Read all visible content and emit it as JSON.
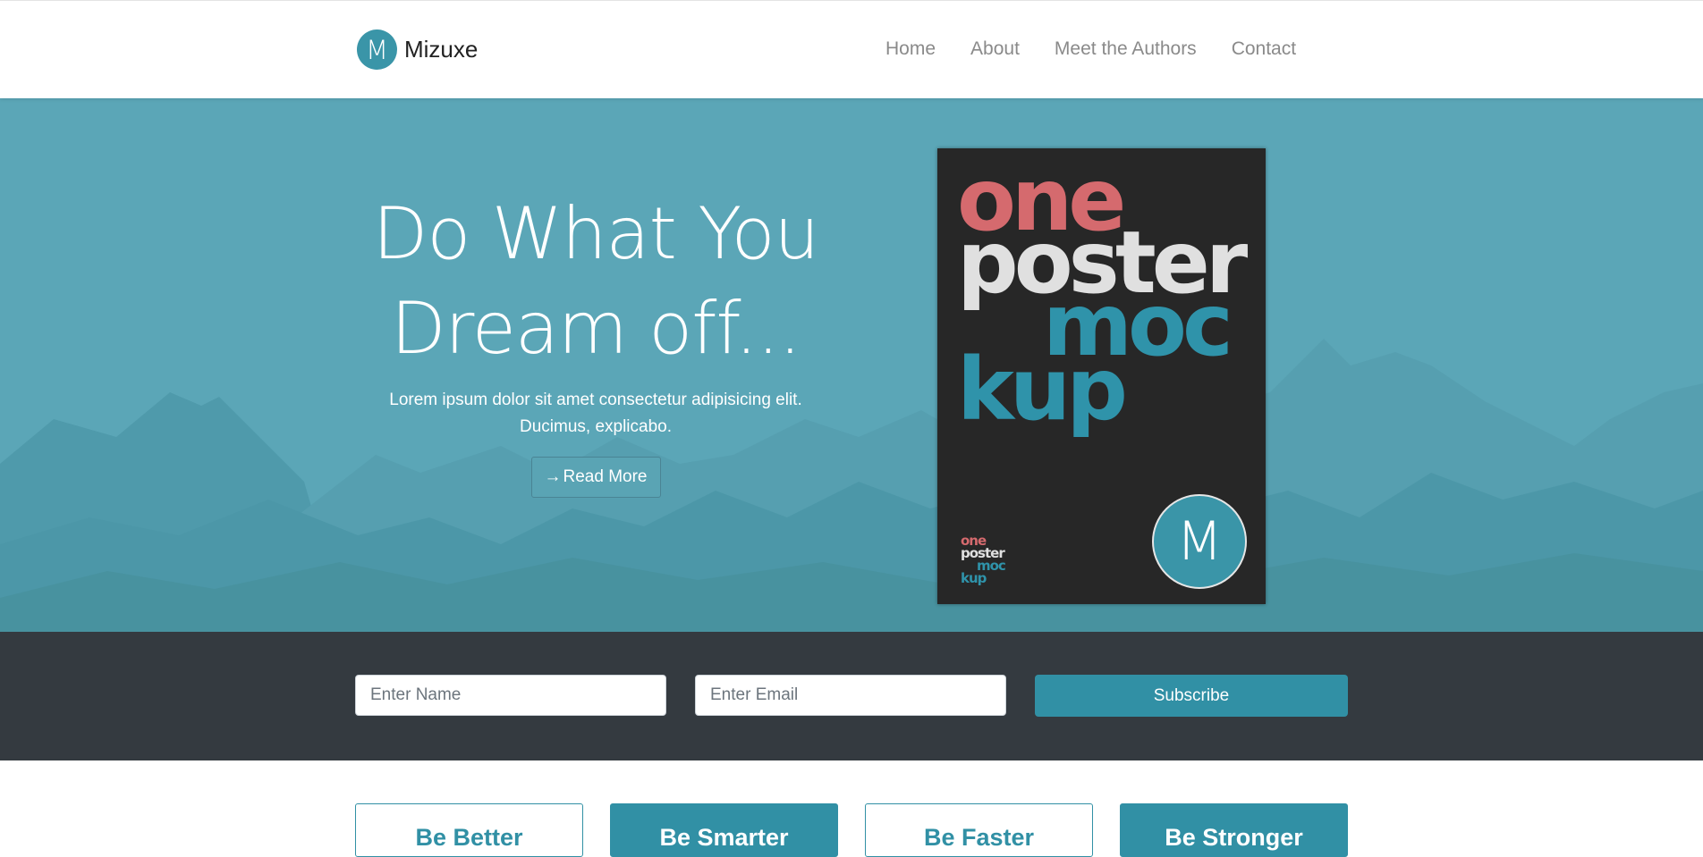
{
  "brand": {
    "logo_letter": "M",
    "name": "Mizuxe"
  },
  "nav": {
    "links": [
      "Home",
      "About",
      "Meet the Authors",
      "Contact"
    ]
  },
  "hero": {
    "title_line1": "Do What You",
    "title_line2": "Dream off...",
    "subtitle_line1": "Lorem ipsum dolor sit amet consectetur adipisicing elit.",
    "subtitle_line2": "Ducimus, explicabo.",
    "button_label": "Read More",
    "button_icon": "arrow-right-icon"
  },
  "poster": {
    "words": [
      "one",
      "poster",
      "moc",
      "kup"
    ],
    "badge_letter": "M"
  },
  "subscribe": {
    "name_placeholder": "Enter Name",
    "email_placeholder": "Enter Email",
    "button_label": "Subscribe"
  },
  "features": [
    "Be Better",
    "Be Smarter",
    "Be Faster",
    "Be Stronger"
  ],
  "colors": {
    "brand": "#3a95a8",
    "hero_bg": "#5ba6b7",
    "dark_bar": "#343a40",
    "button": "#3190a5",
    "poster_red": "#d56a6e",
    "poster_blue": "#2f93aa"
  }
}
